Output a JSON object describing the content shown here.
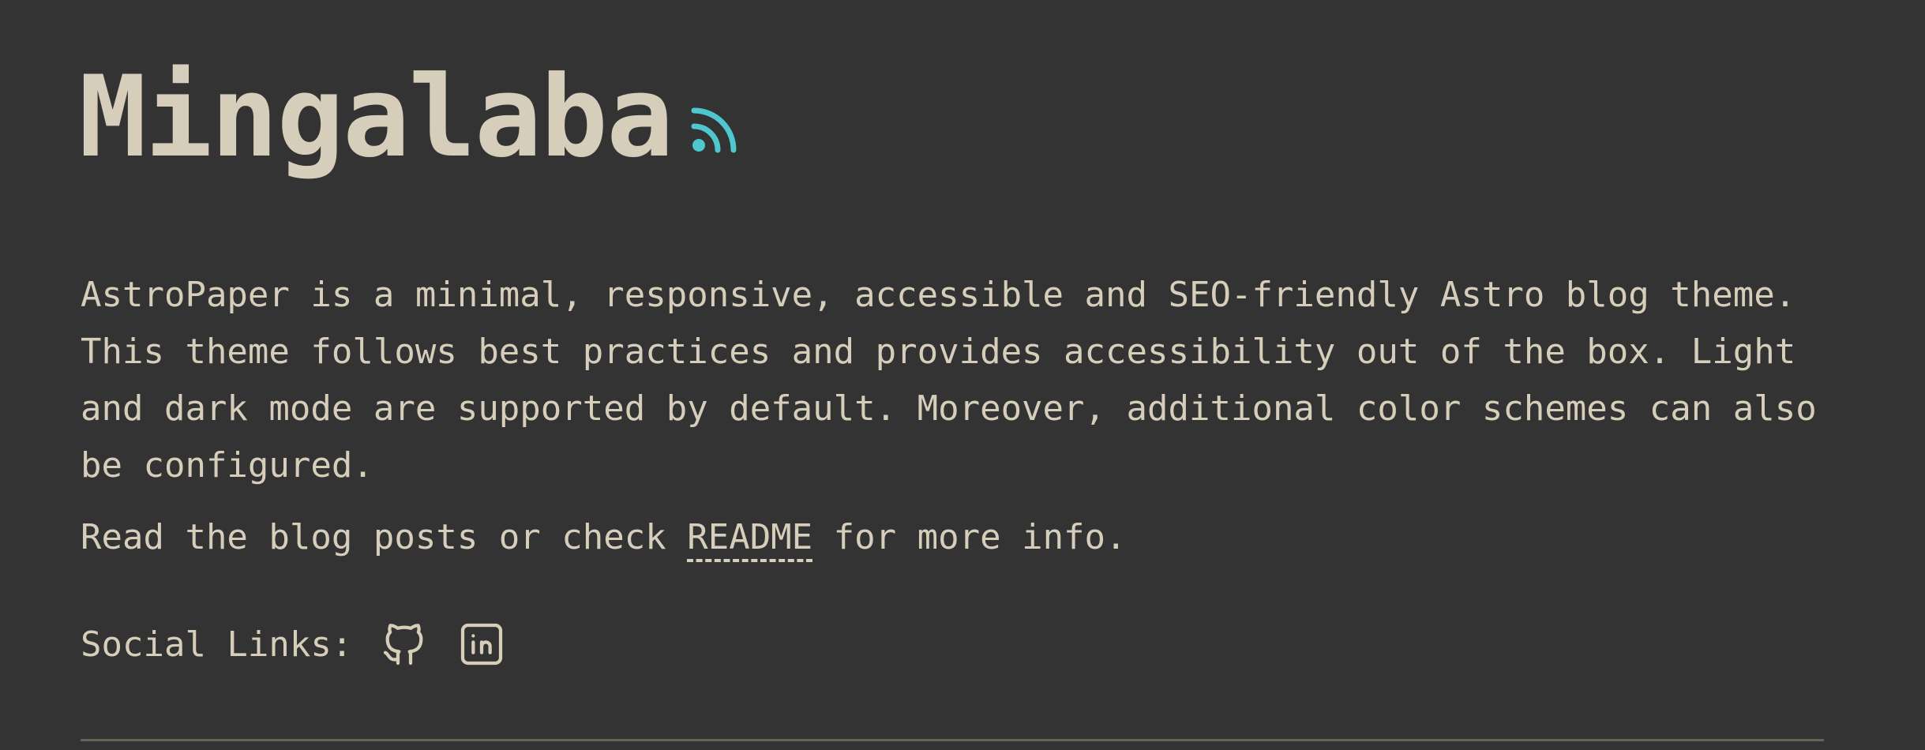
{
  "hero": {
    "title": "Mingalaba",
    "rss_icon": "rss-icon",
    "rss_color": "#4fc7cf"
  },
  "intro": {
    "paragraph": "AstroPaper is a minimal, responsive, accessible and SEO-friendly Astro blog theme. This theme follows best practices and provides accessibility out of the box. Light and dark mode are supported by default. Moreover, additional color schemes can also be configured.",
    "readme_prefix": "Read the blog posts or check ",
    "readme_link": "README",
    "readme_suffix": " for more info."
  },
  "social": {
    "label": "Social Links:",
    "links": [
      {
        "icon": "github-icon"
      },
      {
        "icon": "linkedin-icon"
      }
    ]
  },
  "colors": {
    "background": "#333333",
    "text": "#d6cdba",
    "accent": "#4fc7cf",
    "divider": "#6a6458"
  }
}
